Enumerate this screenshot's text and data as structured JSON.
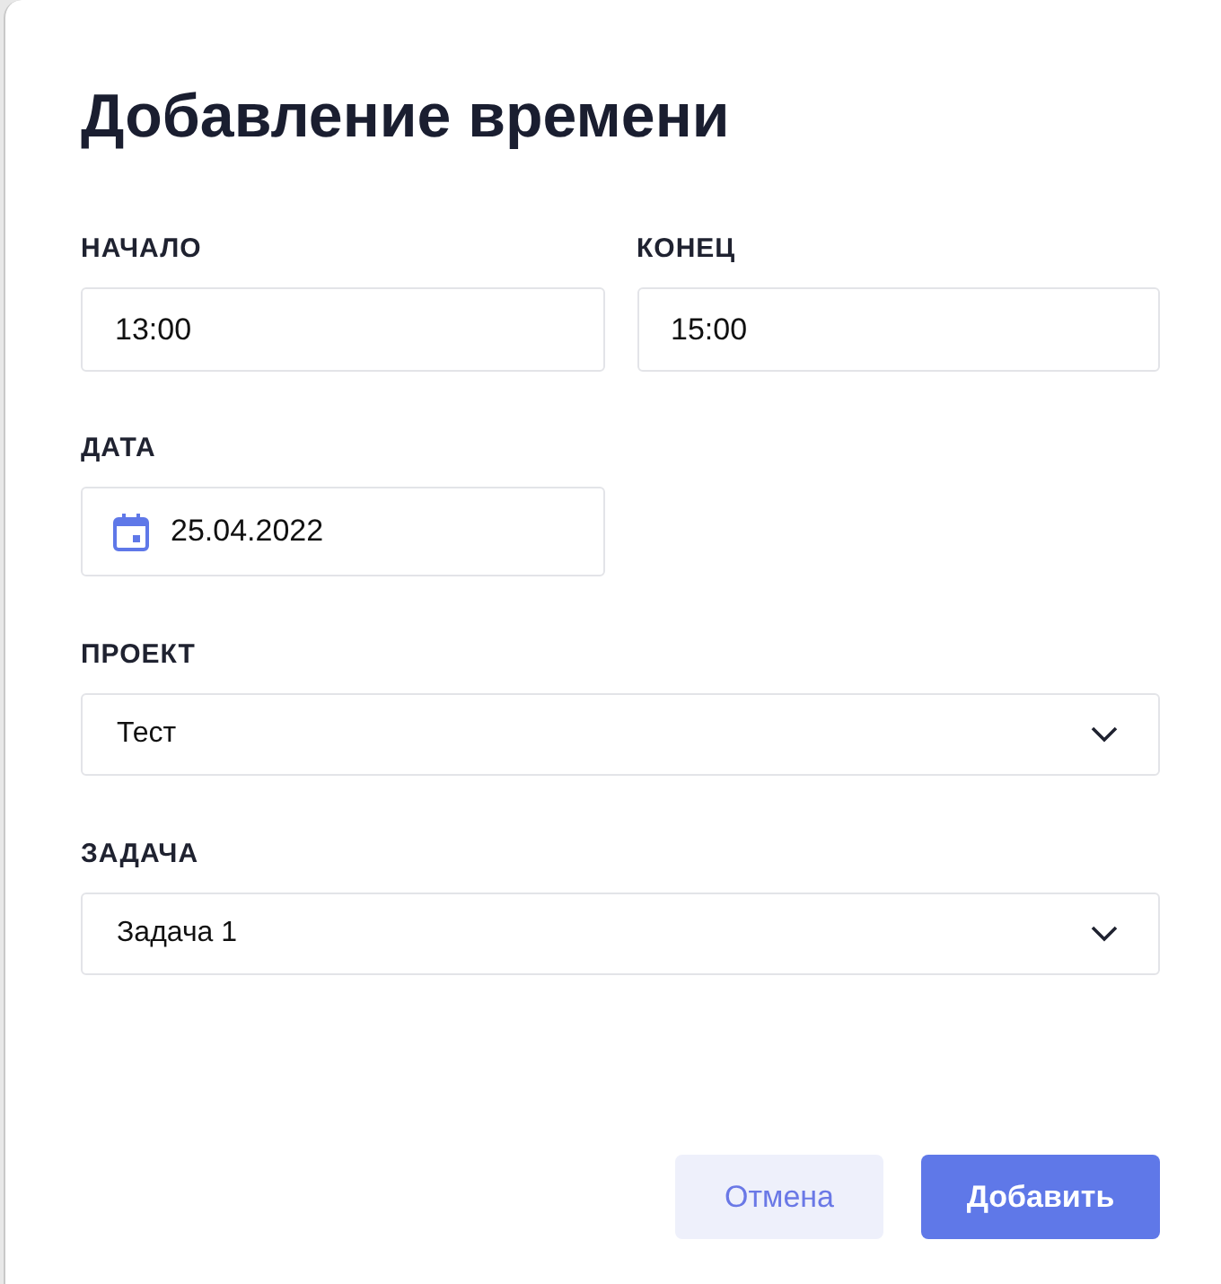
{
  "dialog": {
    "title": "Добавление времени",
    "start": {
      "label": "НАЧАЛО",
      "value": "13:00"
    },
    "end": {
      "label": "КОНЕЦ",
      "value": "15:00"
    },
    "date": {
      "label": "ДАТА",
      "value": "25.04.2022"
    },
    "project": {
      "label": "ПРОЕКТ",
      "value": "Тест"
    },
    "task": {
      "label": "ЗАДАЧА",
      "value": "Задача 1"
    },
    "buttons": [
      {
        "label": "Отмена",
        "kind": "secondary"
      },
      {
        "label": "Добавить",
        "kind": "primary"
      }
    ]
  }
}
